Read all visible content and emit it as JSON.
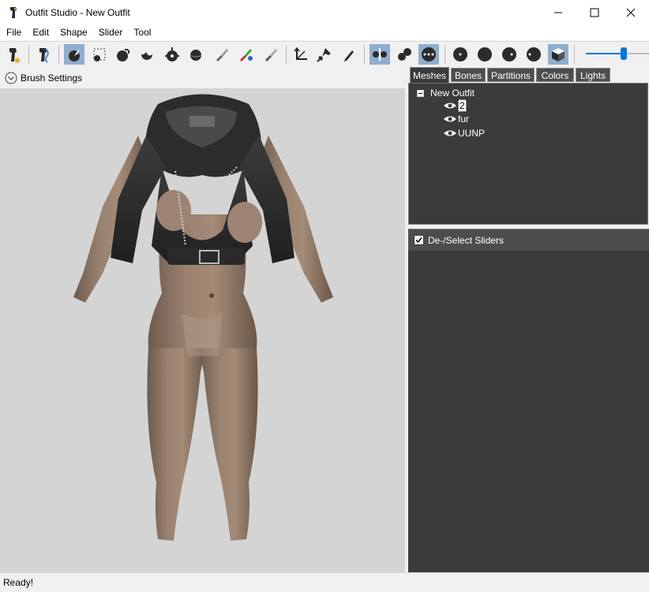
{
  "window": {
    "title": "Outfit Studio - New Outfit",
    "minimize_glyph": "—",
    "maximize_glyph": "☐",
    "close_glyph": "✕"
  },
  "menu": [
    "File",
    "Edit",
    "Shape",
    "Slider",
    "Tool"
  ],
  "toolbar": {
    "icons": [
      "new-project-icon",
      "load-reference-icon",
      "select-brush-icon",
      "mask-brush-icon",
      "inflate-brush-icon",
      "deflate-brush-icon",
      "move-brush-icon",
      "smooth-brush-icon",
      "weight-brush-icon",
      "color-brush-icon",
      "alpha-brush-icon",
      "transform-icon",
      "pivot-icon",
      "vertex-edit-icon",
      "x-mirror-icon",
      "connected-only-icon",
      "global-brush-collision-icon",
      "vertex-view-icon",
      "wireframe-view-icon",
      "lighting-view-icon",
      "texture-view-icon",
      "cube-view-icon"
    ],
    "zoom_level": 0.6
  },
  "left_panel": {
    "brush_settings_label": "Brush Settings"
  },
  "tabs": [
    "Meshes",
    "Bones",
    "Partitions",
    "Colors",
    "Lights"
  ],
  "active_tab": "Meshes",
  "mesh_tree": {
    "root": "New Outfit",
    "items": [
      "2",
      "fur",
      "UUNP"
    ],
    "selected": "2"
  },
  "sliders": {
    "header_label": "De-/Select Sliders",
    "checked": true
  },
  "status": {
    "text": "Ready!"
  },
  "colors": {
    "accent": "#8faecd",
    "panel_dark": "#3b3b3b",
    "viewport_bg": "#d4d4d4"
  }
}
